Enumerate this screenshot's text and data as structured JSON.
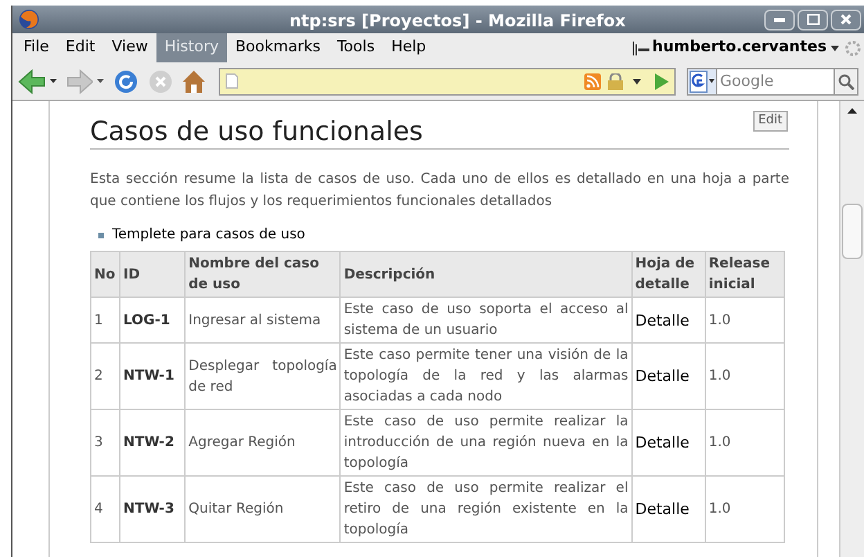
{
  "window": {
    "title": "ntp:srs [Proyectos] - Mozilla Firefox"
  },
  "menu": [
    {
      "label": "File",
      "selected": false
    },
    {
      "label": "Edit",
      "selected": false
    },
    {
      "label": "View",
      "selected": false
    },
    {
      "label": "History",
      "selected": true
    },
    {
      "label": "Bookmarks",
      "selected": false
    },
    {
      "label": "Tools",
      "selected": false
    },
    {
      "label": "Help",
      "selected": false
    }
  ],
  "user": "humberto.cervantes",
  "search": {
    "placeholder": "Google"
  },
  "page": {
    "edit_button": "Edit",
    "heading": "Casos de uso funcionales",
    "intro": "Esta sección resume la lista de casos de uso. Cada uno de ellos es detallado en una hoja a parte que contiene los flujos y los requerimientos funcionales detallados",
    "bullets": [
      "Templete para casos de uso"
    ],
    "table": {
      "columns": [
        "No",
        "ID",
        "Nombre del caso de uso",
        "Descripción",
        "Hoja de detalle",
        "Release inicial"
      ],
      "rows": [
        [
          "1",
          "LOG-1",
          "Ingresar al sistema",
          "Este caso de uso soporta el acceso al sistema de un usuario",
          "Detalle",
          "1.0"
        ],
        [
          "2",
          "NTW-1",
          "Desplegar topología de red",
          "Este caso permite tener una visión de la topología de la red y las alarmas asociadas a cada nodo",
          "Detalle",
          "1.0"
        ],
        [
          "3",
          "NTW-2",
          "Agregar Región",
          "Este caso de uso permite realizar la introducción de una región nueva en la topología",
          "Detalle",
          "1.0"
        ],
        [
          "4",
          "NTW-3",
          "Quitar Región",
          "Este caso de uso permite realizar el retiro de una región existente en la topología",
          "Detalle",
          "1.0"
        ]
      ]
    }
  }
}
